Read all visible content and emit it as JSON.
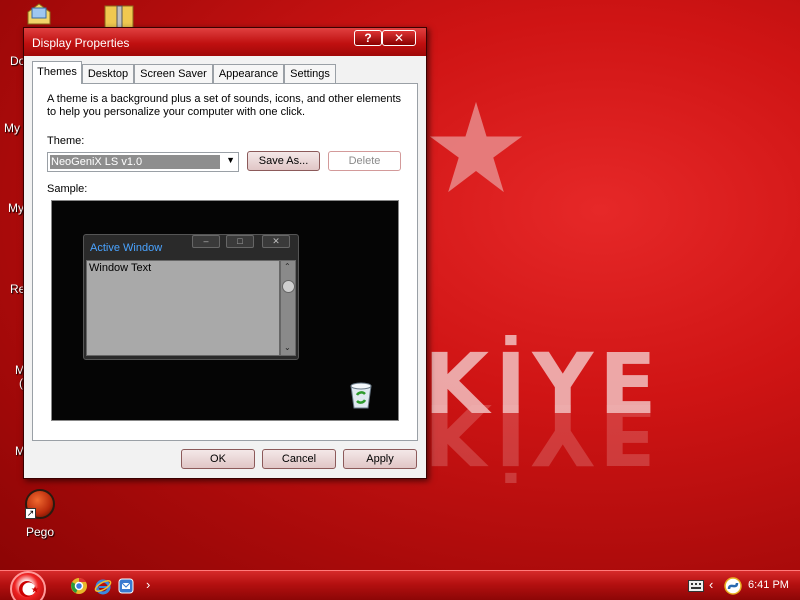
{
  "desktop": {
    "wallpaper_text": "KİYE",
    "icons": [
      {
        "label": "Do"
      },
      {
        "label": "My"
      },
      {
        "label": "My"
      },
      {
        "label": "Re"
      },
      {
        "label": "M"
      },
      {
        "label": "("
      },
      {
        "label": "M"
      },
      {
        "label": "Pego"
      }
    ]
  },
  "window": {
    "title": "Display Properties",
    "help_button": "?",
    "close_button": "✕",
    "tabs": [
      {
        "label": "Themes",
        "active": true
      },
      {
        "label": "Desktop"
      },
      {
        "label": "Screen Saver"
      },
      {
        "label": "Appearance"
      },
      {
        "label": "Settings"
      }
    ],
    "description": "A theme is a background plus a set of sounds, icons, and other elements to help you personalize your computer with one click.",
    "theme_label": "Theme:",
    "theme_value": "NeoGeniX LS v1.0",
    "save_as_label": "Save As...",
    "delete_label": "Delete",
    "sample_label": "Sample:",
    "sample": {
      "active_window_title": "Active Window",
      "window_text": "Window Text"
    },
    "ok_label": "OK",
    "cancel_label": "Cancel",
    "apply_label": "Apply"
  },
  "taskbar": {
    "clock": "6:41 PM",
    "chevron": "›"
  },
  "colors": {
    "accent": "#c01010",
    "active_title": "#4aa3ff"
  }
}
